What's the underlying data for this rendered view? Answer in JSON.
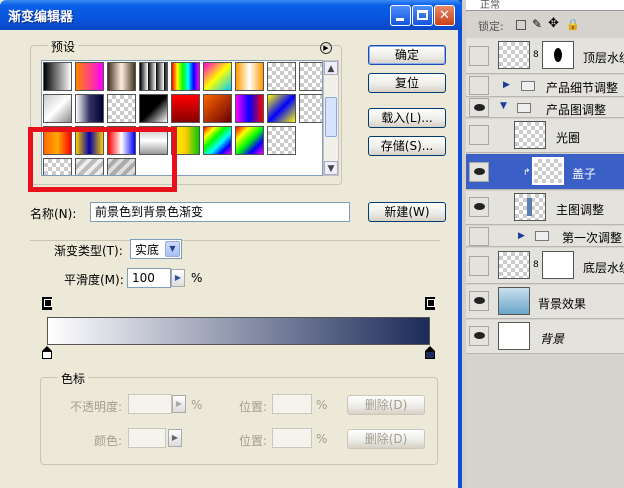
{
  "dialog": {
    "title": "渐变编辑器",
    "presets_label": "预设",
    "buttons": {
      "ok": "确定",
      "reset": "复位",
      "load": "载入(L)...",
      "save": "存储(S)...",
      "new": "新建(W)"
    },
    "name_label": "名称(N):",
    "name_value": "前景色到背景色渐变",
    "gradient_type_label": "渐变类型(T):",
    "gradient_type_value": "实底",
    "smoothness_label": "平滑度(M):",
    "smoothness_value": "100",
    "percent": "%",
    "stops_group": "色标",
    "opacity_label": "不透明度:",
    "location_label": "位置:",
    "delete_label": "删除(D)",
    "color_label": "颜色:",
    "gradient_colors": [
      "#ffffff",
      "#1c2a58"
    ],
    "highlight_color": "#e8101a"
  },
  "layers": {
    "blend_mode": "正常",
    "lock_label": "锁定:",
    "items": [
      {
        "name": "顶层水纹",
        "type": "layer-mask",
        "visible": false
      },
      {
        "name": "产品细节调整",
        "type": "group-collapsed",
        "visible": false
      },
      {
        "name": "产品图调整",
        "type": "group-expanded",
        "visible": true
      },
      {
        "name": "光圈",
        "type": "layer",
        "visible": false
      },
      {
        "name": "盖子",
        "type": "layer",
        "visible": true,
        "selected": true
      },
      {
        "name": "主图调整",
        "type": "layer",
        "visible": true
      },
      {
        "name": "第一次调整",
        "type": "group-collapsed",
        "visible": false
      },
      {
        "name": "底层水纹",
        "type": "layer-mask",
        "visible": false
      },
      {
        "name": "背景效果",
        "type": "layer",
        "visible": true
      },
      {
        "name": "背景",
        "type": "background",
        "visible": true
      }
    ]
  }
}
